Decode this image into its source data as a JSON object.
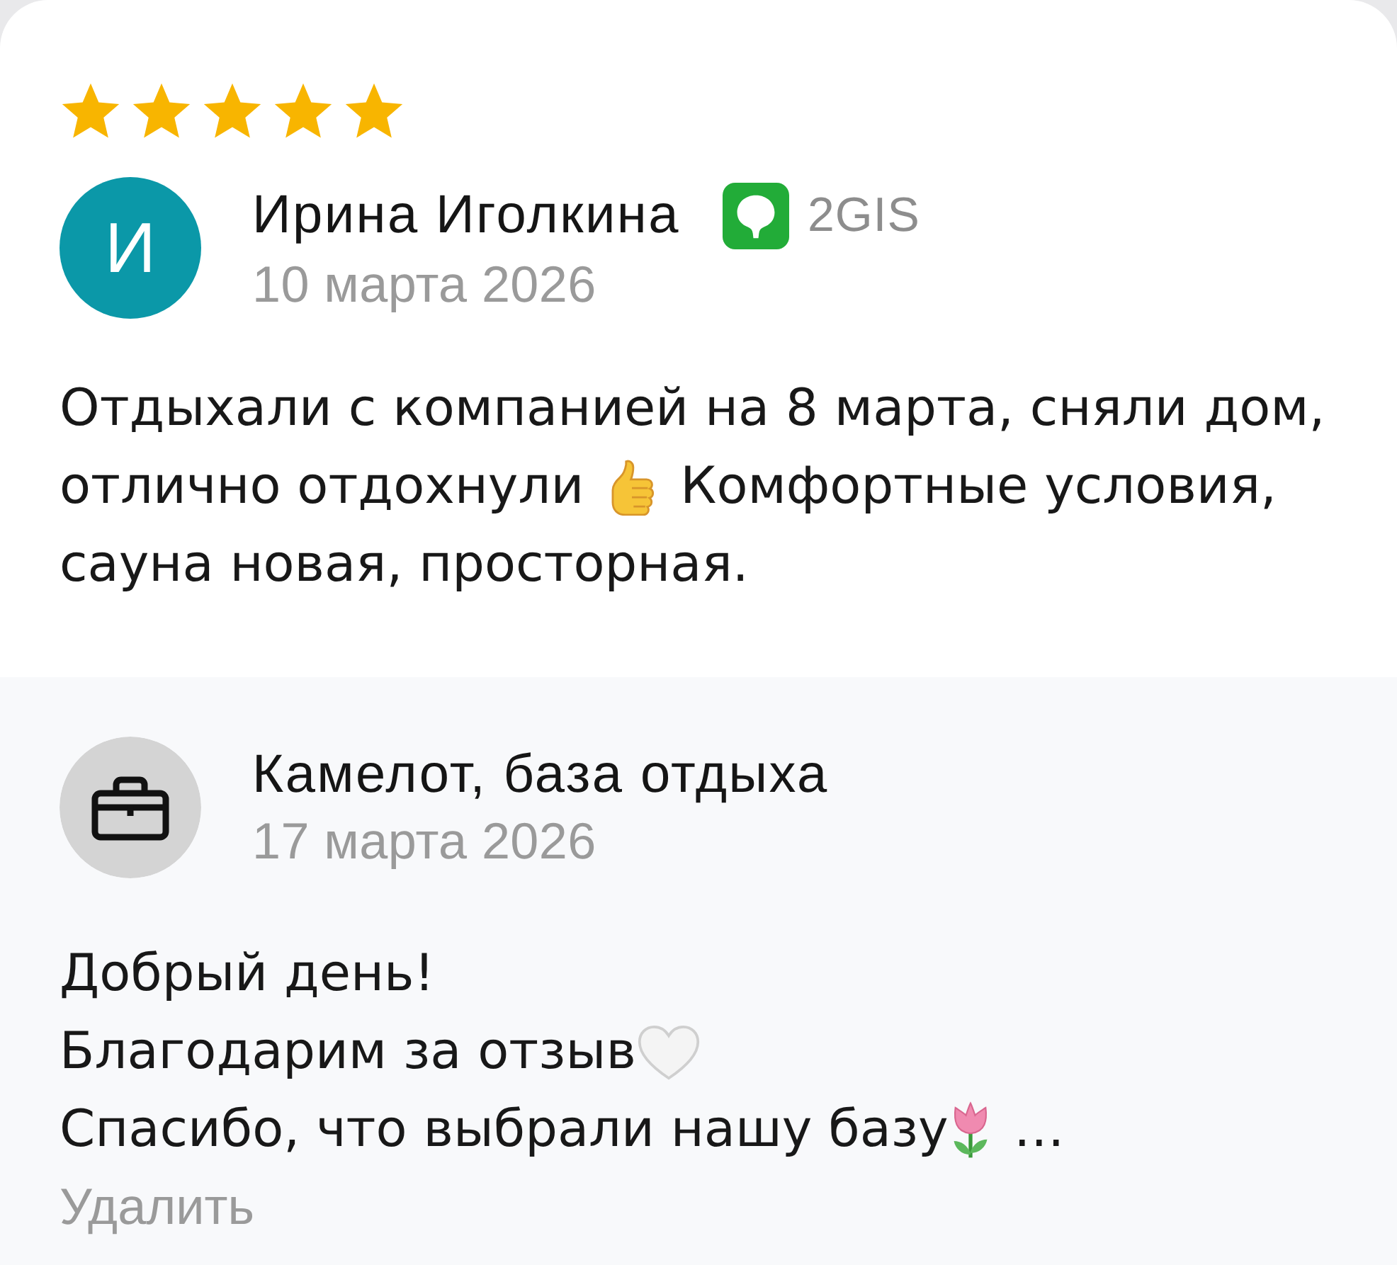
{
  "review": {
    "stars": 5,
    "author": {
      "initial": "И",
      "name": "Ирина Иголкина",
      "date": "10 марта 2026"
    },
    "source": {
      "label": "2GIS"
    },
    "lines": [
      [
        {
          "kind": "text",
          "text": "Отдыхали с компанией на 8 марта, сняли дом,"
        }
      ],
      [
        {
          "kind": "text",
          "text": "отлично отдохнули"
        },
        {
          "kind": "thumbs-up"
        },
        {
          "kind": "text",
          "text": "Комфортные условия,"
        }
      ],
      [
        {
          "kind": "text",
          "text": "сауна новая, просторная."
        }
      ]
    ]
  },
  "reply": {
    "author": {
      "name": "Камелот, база отдыха",
      "date": "17 марта 2026"
    },
    "lines": [
      [
        {
          "kind": "text",
          "text": "Добрый день!"
        }
      ],
      [
        {
          "kind": "text",
          "text": "Благодарим за отзыв"
        },
        {
          "kind": "heart"
        }
      ],
      [
        {
          "kind": "text",
          "text": "Спасибо, что выбрали нашу базу"
        },
        {
          "kind": "tulip"
        },
        {
          "kind": "text",
          "text": "…"
        }
      ]
    ],
    "delete_label": "Удалить"
  }
}
